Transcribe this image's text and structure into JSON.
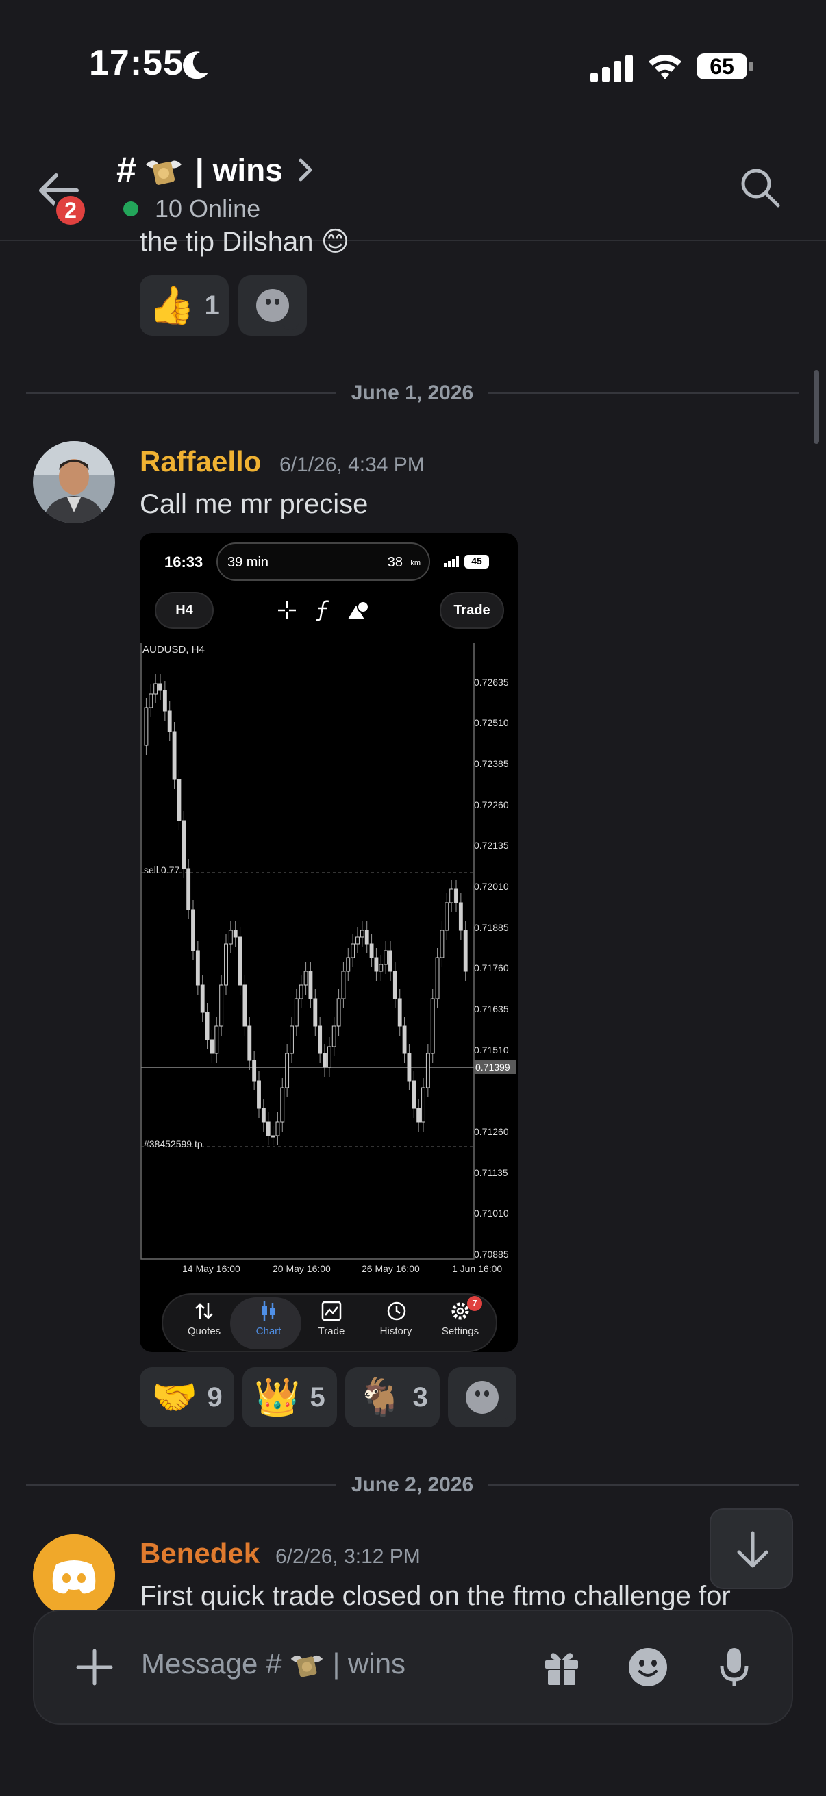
{
  "status_bar": {
    "time": "17:55",
    "battery": "65"
  },
  "header": {
    "unread_badge": "2",
    "channel_hash": "#",
    "channel_name": "| wins",
    "online": "10 Online"
  },
  "previous_message": {
    "text_tail": "the tip Dilshan 😊",
    "reactions": [
      {
        "emoji": "👍",
        "count": "1"
      }
    ]
  },
  "dividers": {
    "first": "June 1, 2026",
    "second": "June 2, 2026"
  },
  "messages": [
    {
      "author": "Raffaello",
      "author_color": "#f0b232",
      "timestamp": "6/1/26, 4:34 PM",
      "text": "Call me mr precise",
      "reactions": [
        {
          "emoji": "🤝",
          "count": "9"
        },
        {
          "emoji": "👑",
          "count": "5"
        },
        {
          "emoji": "🐐",
          "count": "3"
        }
      ]
    },
    {
      "author": "Benedek",
      "author_color": "#e07b2e",
      "timestamp": "6/2/26, 3:12 PM",
      "text": "First quick trade closed on the ftmo challenge for"
    }
  ],
  "attachment": {
    "status_time": "16:33",
    "live_activity_left": "39 min",
    "live_activity_right": "38",
    "live_activity_unit": "km",
    "battery": "45",
    "timeframe_button": "H4",
    "trade_button": "Trade",
    "symbol": "AUDUSD, H4",
    "sell_label": "sell 0.77",
    "tp_label": "#38452599 tp",
    "current_price": "0.71399",
    "price_ticks": [
      "0.72635",
      "0.72510",
      "0.72385",
      "0.72260",
      "0.72135",
      "0.72010",
      "0.71885",
      "0.71760",
      "0.71635",
      "0.71510",
      "0.71260",
      "0.71135",
      "0.71010",
      "0.70885"
    ],
    "time_ticks": [
      "14 May 16:00",
      "20 May 16:00",
      "26 May 16:00",
      "1 Jun 16:00"
    ],
    "nav": [
      {
        "label": "Quotes",
        "icon": "quotes-icon"
      },
      {
        "label": "Chart",
        "icon": "candles-icon",
        "active": true
      },
      {
        "label": "Trade",
        "icon": "trade-chart-icon"
      },
      {
        "label": "History",
        "icon": "history-icon"
      },
      {
        "label": "Settings",
        "icon": "gear-icon",
        "badge": "7"
      }
    ]
  },
  "composer": {
    "placeholder_prefix": "Message #",
    "placeholder_suffix": "| wins"
  },
  "colors": {
    "background": "#1a1a1e",
    "accent_online": "#23a55a",
    "badge_red": "#e0413f",
    "active_tab": "#4f8fe6"
  }
}
